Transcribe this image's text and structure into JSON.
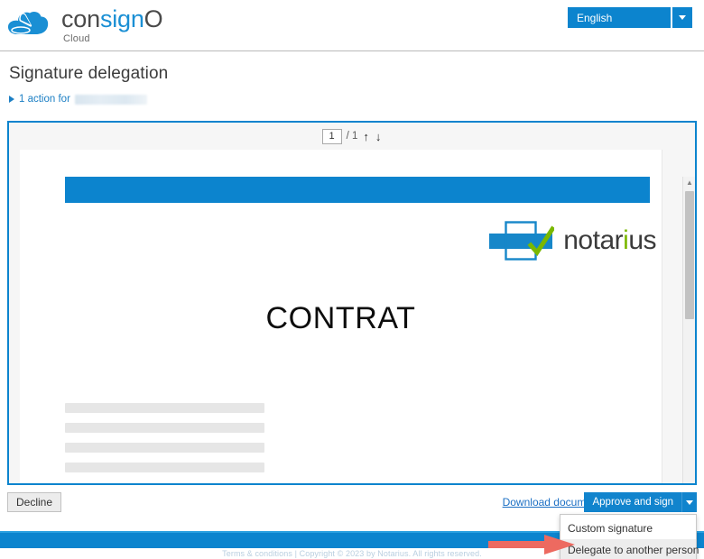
{
  "header": {
    "brand_name_pre": "con",
    "brand_name_hl": "sign",
    "brand_name_post": "O",
    "brand_sub": "Cloud",
    "logo_icon": "cloud-pen-icon",
    "language_value": "English",
    "language_caret_icon": "chevron-down-icon"
  },
  "page": {
    "title": "Signature delegation",
    "action_summary": "1 action for",
    "action_toggle_icon": "triangle-right-icon",
    "redacted_recipient": ""
  },
  "viewer": {
    "current_page": "1",
    "page_separator": "/ 1",
    "prev_icon": "arrow-up-icon",
    "next_icon": "arrow-down-icon",
    "prev_glyph": "↑",
    "next_glyph": "↓",
    "scroll_up_glyph": "▲",
    "scroll_down_glyph": "▼"
  },
  "document": {
    "heading": "CONTRAT",
    "logo_text_pre": "notar",
    "logo_text_hl": "i",
    "logo_text_post": "us",
    "logo_icon": "notarius-check-icon",
    "banner_color": "#0c84ce",
    "placeholder_lines": 4
  },
  "actions": {
    "decline_label": "Decline",
    "download_label": "Download document",
    "approve_label": "Approve and sign",
    "approve_caret_icon": "chevron-down-icon",
    "menu_items": [
      {
        "label": "Custom signature",
        "active": false
      },
      {
        "label": "Delegate to another person",
        "active": true
      }
    ]
  },
  "footer": {
    "text": "Terms & conditions | Copyright © 2023 by Notarius. All rights reserved."
  },
  "annotation": {
    "arrow_icon": "red-arrow-right-icon",
    "arrow_color": "#e8605a"
  },
  "colors": {
    "brand_blue": "#0c84ce",
    "accent_blue": "#1184cd",
    "link_blue": "#1b6fc4",
    "green": "#7ab800"
  }
}
